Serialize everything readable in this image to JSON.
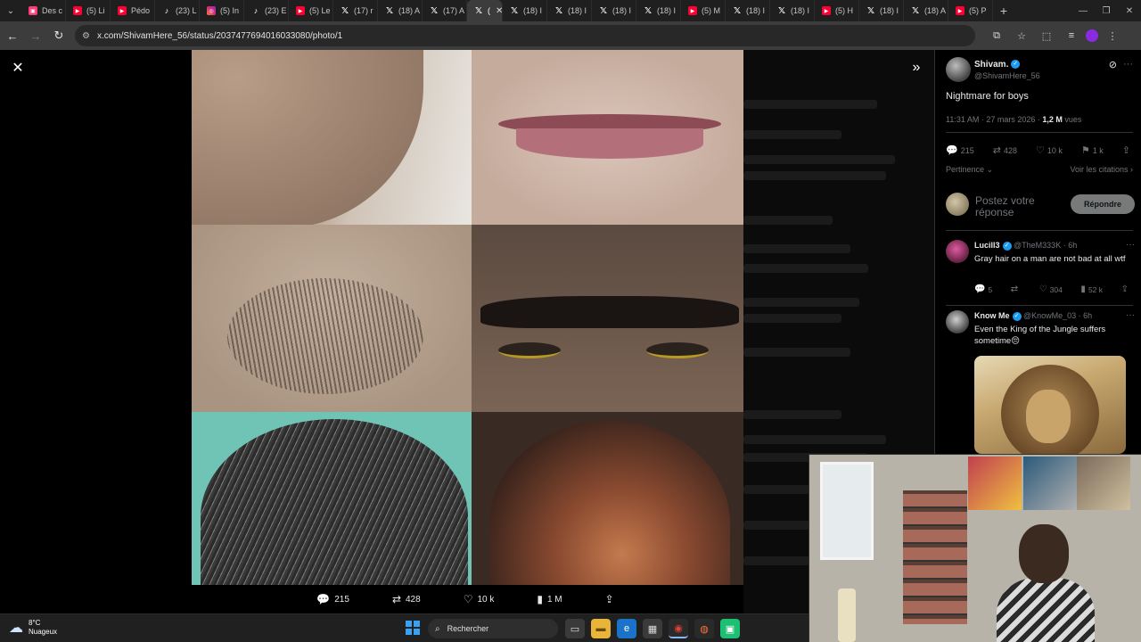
{
  "browser": {
    "tabs": [
      {
        "label": "Des c",
        "icon": "tv-icon"
      },
      {
        "label": "(5) Li",
        "icon": "youtube-icon"
      },
      {
        "label": "Pédo",
        "icon": "youtube-icon"
      },
      {
        "label": "(23) L",
        "icon": "tiktok-icon"
      },
      {
        "label": "(5) In",
        "icon": "instagram-icon"
      },
      {
        "label": "(23) E",
        "icon": "tiktok-icon"
      },
      {
        "label": "(5) Le",
        "icon": "youtube-icon"
      },
      {
        "label": "(17) r",
        "icon": "x-icon"
      },
      {
        "label": "(18) A",
        "icon": "x-icon"
      },
      {
        "label": "(17) A",
        "icon": "x-icon"
      },
      {
        "label": "(",
        "icon": "x-icon",
        "active": true
      },
      {
        "label": "(18) I",
        "icon": "x-icon"
      },
      {
        "label": "(18) I",
        "icon": "x-icon"
      },
      {
        "label": "(18) I",
        "icon": "x-icon"
      },
      {
        "label": "(18) I",
        "icon": "x-icon"
      },
      {
        "label": "(5) M",
        "icon": "youtube-icon"
      },
      {
        "label": "(18) I",
        "icon": "x-icon"
      },
      {
        "label": "(18) I",
        "icon": "x-icon"
      },
      {
        "label": "(5) H",
        "icon": "youtube-icon"
      },
      {
        "label": "(18) I",
        "icon": "x-icon"
      },
      {
        "label": "(18) A",
        "icon": "x-icon"
      },
      {
        "label": "(5) P",
        "icon": "youtube-icon"
      }
    ],
    "url": "x.com/ShivamHere_56/status/2037477694016033080/photo/1"
  },
  "post": {
    "author_name": "Shivam.",
    "author_handle": "@ShivamHere_56",
    "text": "Nightmare for boys",
    "time": "11:31 AM · 27 mars 2026 · ",
    "views": "1,2 M",
    "views_suffix": " vues",
    "replies": "215",
    "reposts": "428",
    "likes": "10 k",
    "bookmarks": "1 k",
    "sort_label": "Pertinence",
    "quotes_link": "Voir les citations",
    "reply_placeholder": "Postez votre réponse",
    "reply_button": "Répondre"
  },
  "viewer_actions": {
    "replies": "215",
    "reposts": "428",
    "likes": "10 k",
    "views": "1 M"
  },
  "replies": [
    {
      "name": "Lucill3",
      "handle": "@TheM333K · 6h",
      "text": "Gray hair on a man are not bad at all wtf",
      "replies": "5",
      "likes": "304",
      "views": "52 k"
    },
    {
      "name": "Know Me",
      "handle": "@KnowMe_03 · 6h",
      "text": "Even the King of the Jungle suffers sometime😔"
    }
  ],
  "taskbar": {
    "temp": "8°C",
    "weather": "Nuageux",
    "search": "Rechercher"
  },
  "colors": {
    "accent": "#1d9bf0",
    "background": "#000000",
    "muted": "#71767b"
  }
}
